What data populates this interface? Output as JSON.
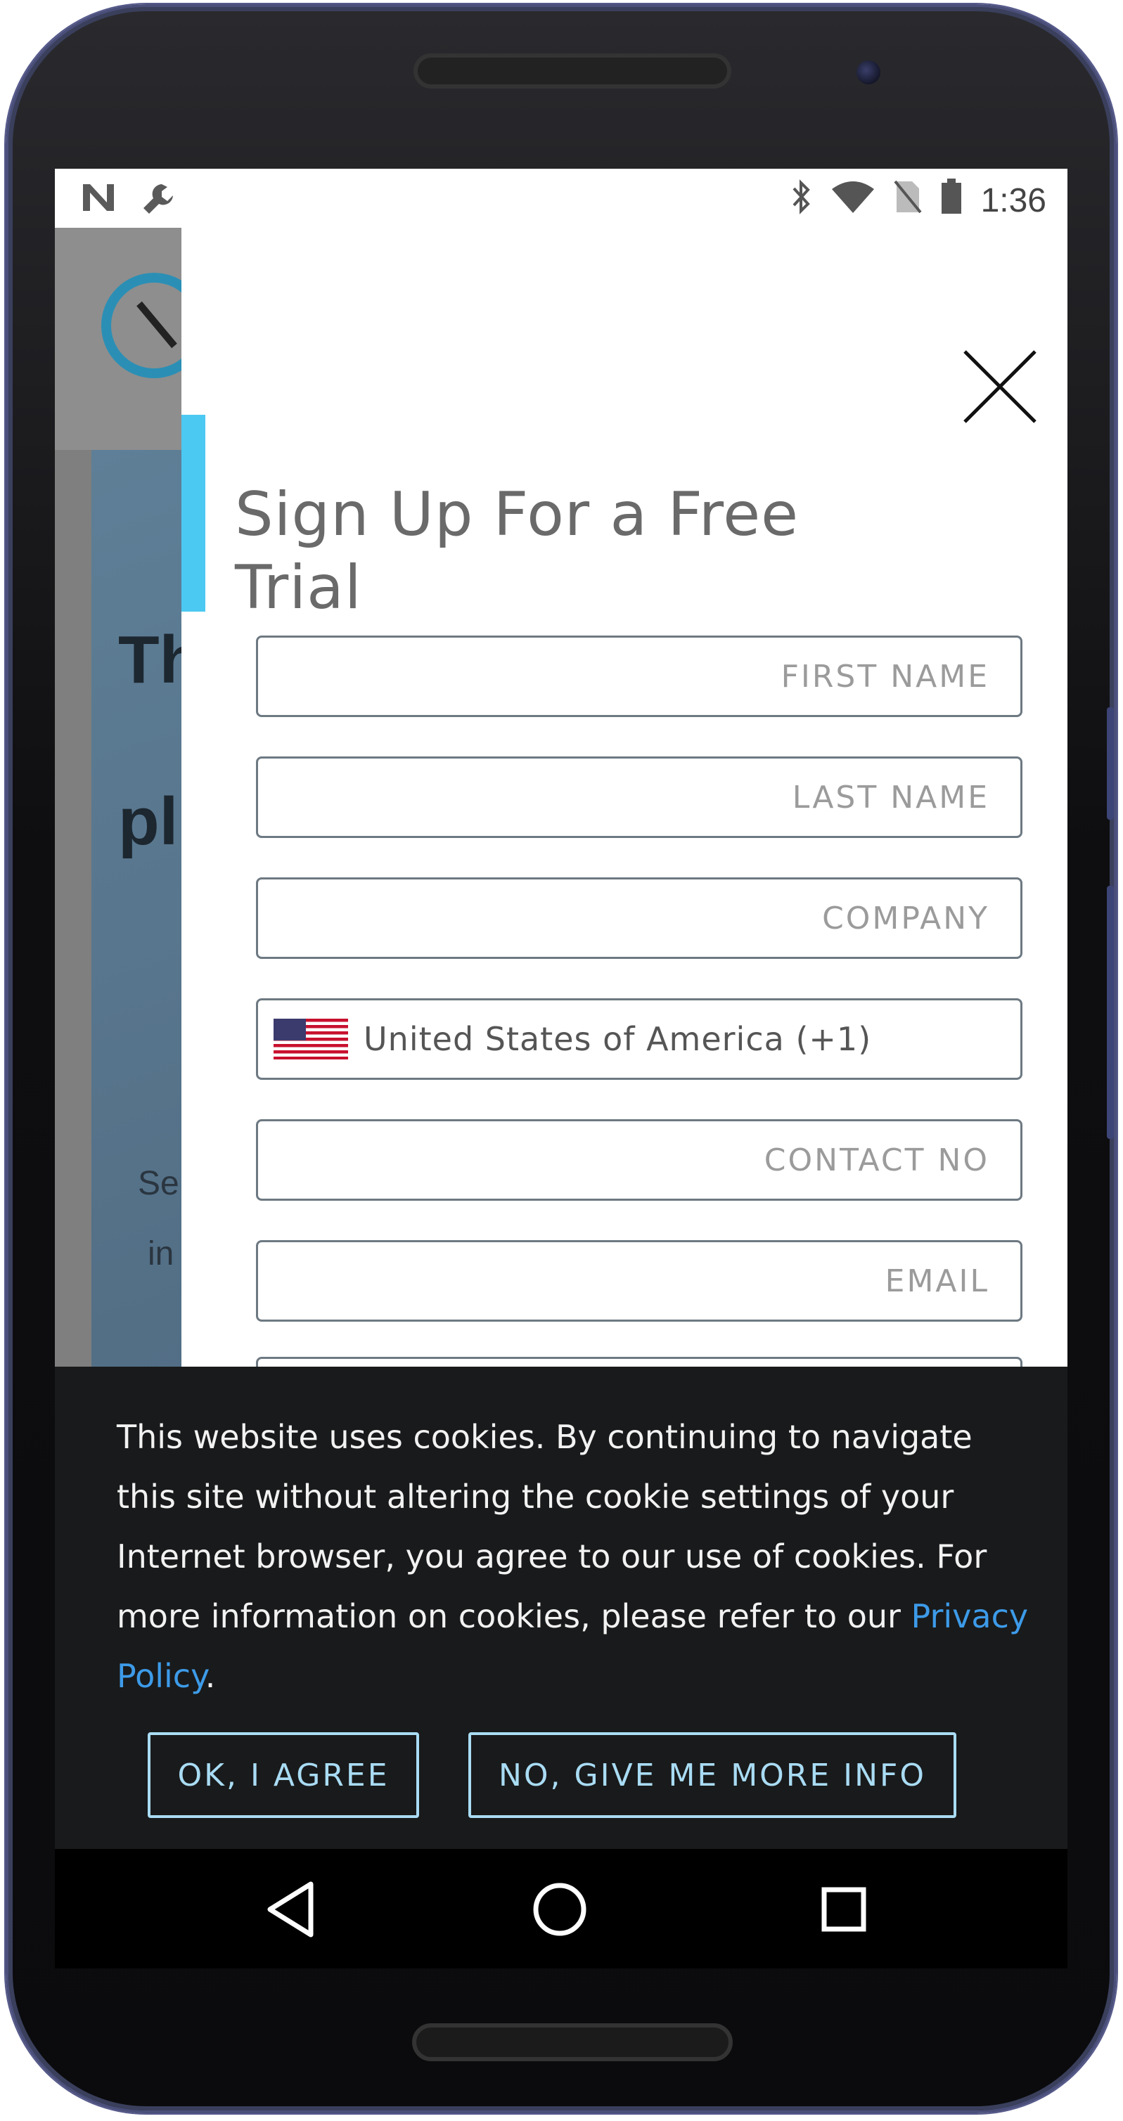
{
  "status_bar": {
    "left_icons": [
      "n-logo-icon",
      "wrench-icon"
    ],
    "right_icons": [
      "bluetooth-icon",
      "wifi-icon",
      "no-sim-icon",
      "battery-icon"
    ],
    "time": "1:36"
  },
  "background_page": {
    "hero_title_partial_1": "Th",
    "hero_title_partial_2": "pl",
    "hero_sub_partial_1": "Se",
    "hero_sub_partial_2": "in"
  },
  "modal": {
    "title": "Sign Up For a Free Trial",
    "close_icon": "close-icon",
    "fields": {
      "first_name_placeholder": "FIRST NAME",
      "last_name_placeholder": "LAST NAME",
      "company_placeholder": "COMPANY",
      "country_value": "United States of America (+1)",
      "contact_placeholder": "CONTACT NO",
      "email_placeholder": "EMAIL"
    }
  },
  "cookie_banner": {
    "text": "This website uses cookies. By continuing to navigate this site without altering the cookie settings of your Internet browser, you agree to our use of cookies. For more information on cookies, please refer to our ",
    "link_text": "Privacy Policy",
    "text_end": ".",
    "agree_button": "OK, I AGREE",
    "more_info_button": "NO, GIVE ME MORE INFO",
    "link_color": "#3d9be9",
    "button_color": "#a9dcf4"
  },
  "nav_bar": {
    "back": "back-triangle-icon",
    "home": "home-circle-icon",
    "recents": "recents-square-icon"
  }
}
